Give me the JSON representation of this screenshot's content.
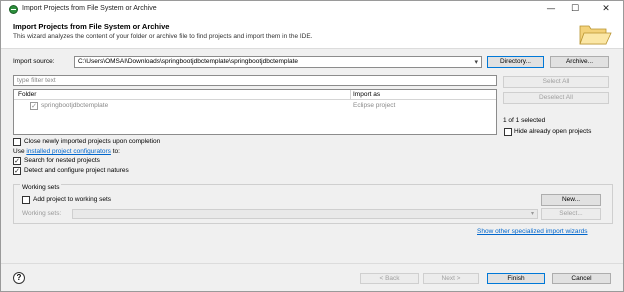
{
  "window": {
    "title": "Import Projects from File System or Archive",
    "minimize": "—",
    "maximize": "☐",
    "close": "✕"
  },
  "banner": {
    "title": "Import Projects from File System or Archive",
    "description": "This wizard analyzes the content of your folder or archive file to find projects and import them in the IDE."
  },
  "import_source": {
    "label": "Import source:",
    "value": "C:\\Users\\OMSAI\\Downloads\\springbootjdbctemplate\\springbootjdbctemplate",
    "directory_button": "Directory...",
    "archive_button": "Archive..."
  },
  "filter": {
    "placeholder": "type filter text"
  },
  "table": {
    "columns": [
      "Folder",
      "Import as"
    ],
    "rows": [
      {
        "folder": "springbootjdbctemplate",
        "import_as": "Eclipse project",
        "checked": true
      }
    ]
  },
  "side": {
    "select_all": "Select All",
    "deselect_all": "Deselect All",
    "selected_count": "1 of 1 selected",
    "hide_open": "Hide already open projects"
  },
  "options": {
    "close_new": "Close newly imported projects upon completion",
    "use_prefix": "Use ",
    "configurators_link": "installed project configurators",
    "use_suffix": " to:",
    "search_nested": "Search for nested projects",
    "detect_natures": "Detect and configure project natures"
  },
  "working_sets": {
    "title": "Working sets",
    "add_label": "Add project to working sets",
    "new_button": "New...",
    "sets_label": "Working sets:",
    "select_button": "Select..."
  },
  "show_wizards_link": "Show other specialized import wizards",
  "footer": {
    "help": "?",
    "back": "< Back",
    "next": "Next >",
    "finish": "Finish",
    "cancel": "Cancel"
  }
}
